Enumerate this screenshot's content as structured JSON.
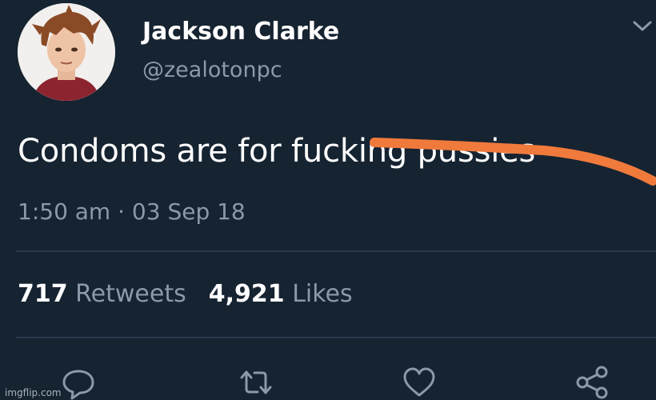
{
  "tweet": {
    "author": {
      "display_name": "Jackson Clarke",
      "handle": "@zealotonpc",
      "avatar": "cartoon-avatar"
    },
    "text": "Condoms are for fucking pussies",
    "timestamp": "1:50 am · 03 Sep 18",
    "stats": {
      "retweets_count": "717",
      "retweets_label": "Retweets",
      "likes_count": "4,921",
      "likes_label": "Likes"
    },
    "actions": [
      {
        "name": "reply",
        "icon": "comment-icon"
      },
      {
        "name": "retweet",
        "icon": "retweet-icon"
      },
      {
        "name": "like",
        "icon": "heart-icon"
      },
      {
        "name": "share",
        "icon": "share-icon"
      }
    ]
  },
  "watermark": "imgflip.com",
  "colors": {
    "background": "#162331",
    "secondary_text": "#8a9aa8",
    "strike_mark": "#f07a3c"
  }
}
